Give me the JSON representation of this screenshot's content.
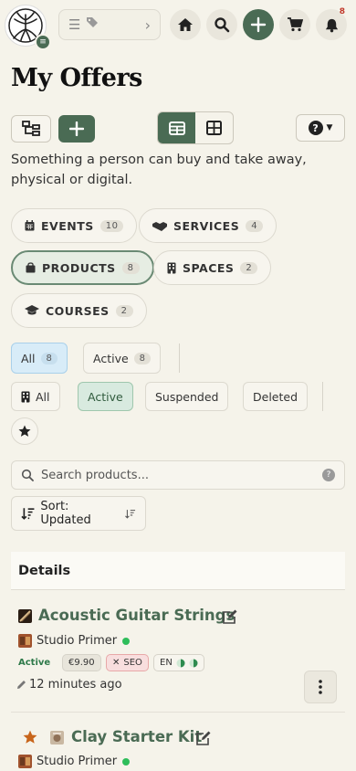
{
  "header": {
    "notification_count": "8",
    "icons": [
      "logo-tree",
      "menu-icon",
      "tag-icon",
      "chevron-right-icon",
      "home-icon",
      "search-icon",
      "plus-icon",
      "cart-icon",
      "bell-icon"
    ]
  },
  "page": {
    "title": "My Offers",
    "description": "Something a person can buy and take away, physical or digital."
  },
  "categories": [
    {
      "label": "EVENTS",
      "count": "10"
    },
    {
      "label": "SERVICES",
      "count": "4"
    },
    {
      "label": "PRODUCTS",
      "count": "8",
      "selected": true
    },
    {
      "label": "SPACES",
      "count": "2"
    },
    {
      "label": "COURSES",
      "count": "2"
    }
  ],
  "filters": {
    "all_label": "All",
    "all_count": "8",
    "active_label": "Active",
    "active_count": "8",
    "scope_all": "All",
    "status_active": "Active",
    "status_suspended": "Suspended",
    "status_deleted": "Deleted"
  },
  "search": {
    "placeholder": "Search products...",
    "help": "?"
  },
  "sort": {
    "label": "Sort: Updated"
  },
  "details": {
    "heading": "Details"
  },
  "items": [
    {
      "title": "Acoustic Guitar Strings",
      "seller": "Studio Primer",
      "status": "Active",
      "price": "€9.90",
      "seo": "SEO",
      "lang": "EN",
      "updated": "12 minutes ago"
    },
    {
      "title": "Clay Starter Kit",
      "seller": "Studio Primer"
    }
  ],
  "colors": {
    "accent": "#4a6b54",
    "background": "#f5f3ea",
    "online": "#2ebd5a",
    "danger": "#c0392b"
  }
}
